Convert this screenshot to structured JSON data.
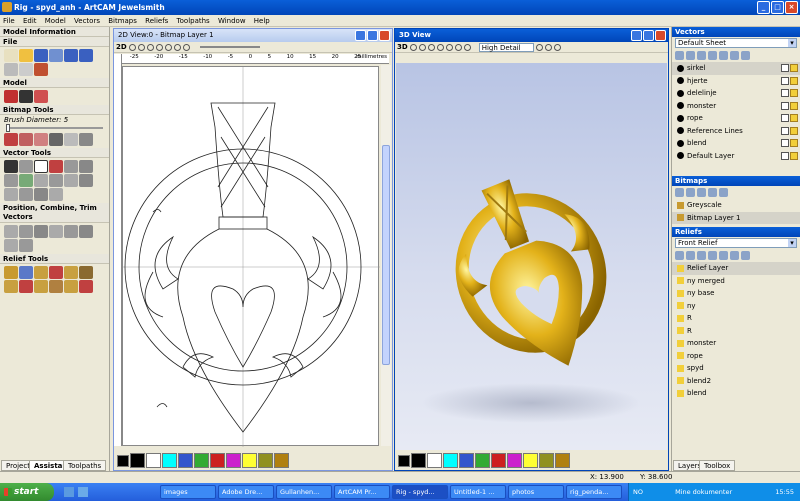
{
  "window": {
    "title": "Rig - spyd_anh - ArtCAM Jewelsmith"
  },
  "menu": [
    "File",
    "Edit",
    "Model",
    "Vectors",
    "Bitmaps",
    "Reliefs",
    "Toolpaths",
    "Window",
    "Help"
  ],
  "left_panel": {
    "model_information": "Model Information",
    "file": "File",
    "model": "Model",
    "bitmap_tools": "Bitmap Tools",
    "brush_label": "Brush Diameter:",
    "brush_value": "5",
    "vector_tools": "Vector Tools",
    "position_label": "Position, Combine, Trim Vectors",
    "relief_tools": "Relief Tools",
    "tabs": [
      "Project",
      "Assistant",
      "Toolpaths"
    ]
  },
  "view2d": {
    "title": "2D View:0 - Bitmap Layer 1",
    "label": "2D",
    "ruler_unit": "millimetres",
    "ruler_ticks": [
      "-25",
      "-20",
      "-15",
      "-10",
      "-5",
      "0",
      "5",
      "10",
      "15",
      "20",
      "25"
    ]
  },
  "view3d": {
    "title": "3D View",
    "label": "3D",
    "detail": "High Detail"
  },
  "palette": [
    "#000000",
    "#ffffff",
    "#00ffff",
    "#3355cc",
    "#33aa33",
    "#cc2020",
    "#cc22cc",
    "#ffff33",
    "#909020",
    "#b08010"
  ],
  "vectors": {
    "header": "Vectors",
    "sheet": "Default Sheet",
    "layers": [
      "sirkel",
      "hjerte",
      "delelinje",
      "monster",
      "rope",
      "Reference Lines",
      "blend",
      "Default Layer"
    ]
  },
  "bitmaps": {
    "header": "Bitmaps",
    "layers": [
      "Greyscale",
      "Bitmap Layer 1"
    ]
  },
  "reliefs": {
    "header": "Reliefs",
    "selected": "Front Relief",
    "layers": [
      "Relief Layer",
      "ny merged",
      "ny base",
      "ny",
      "R",
      "R",
      "monster",
      "rope",
      "spyd",
      "blend2",
      "blend"
    ]
  },
  "right_tabs": [
    "Layers",
    "Toolbox"
  ],
  "status": {
    "x": "X: 13.900",
    "y": "Y: 38.600"
  },
  "taskbar": {
    "start": "start",
    "items": [
      "images",
      "Adobe Dre...",
      "Gullanhen...",
      "ArtCAM Pr...",
      "Rig - spyd...",
      "Untitled-1 ...",
      "photos",
      "rig_penda..."
    ],
    "tray_lang": "NO",
    "tray_text": "Mine dokumenter",
    "time": "15:55"
  }
}
